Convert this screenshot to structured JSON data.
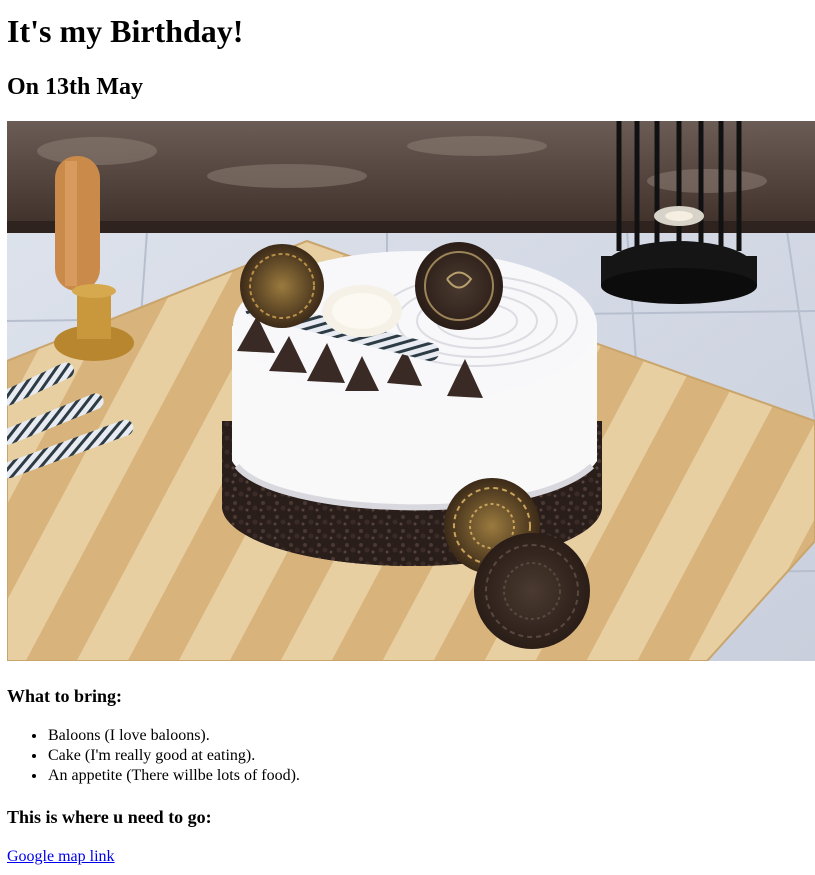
{
  "page": {
    "title": "It's my Birthday!",
    "subtitle": "On 13th May",
    "bring_heading": "What to bring:",
    "bring_items": [
      "Baloons (I love baloons).",
      "Cake (I'm really good at eating).",
      "An appetite (There willbe lots of food)."
    ],
    "go_heading": "This is where u need to go:",
    "map_link": "Google map link"
  },
  "colors": {
    "link": "#0000ee",
    "text": "#000000",
    "background": "#ffffff"
  }
}
